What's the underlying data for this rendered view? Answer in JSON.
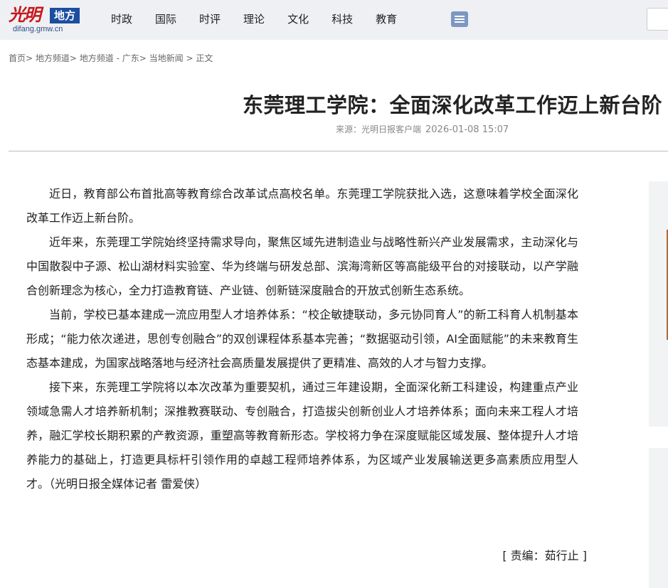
{
  "header": {
    "logo": {
      "script_text": "光明",
      "box_text": "地方",
      "url_text": "difang.gmw.cn"
    },
    "nav": [
      "时政",
      "国际",
      "时评",
      "理论",
      "文化",
      "科技",
      "教育"
    ],
    "menu_icon": "list-menu-icon"
  },
  "breadcrumb": {
    "items": [
      "首页",
      "地方频道",
      "地方频道 - 广东",
      "当地新闻"
    ],
    "current": "正文"
  },
  "article": {
    "title": "东莞理工学院：全面深化改革工作迈上新台阶",
    "source": "来源：光明日报客户端",
    "time": "2026-01-08 15:07",
    "paragraphs": [
      "近日，教育部公布首批高等教育综合改革试点高校名单。东莞理工学院获批入选，这意味着学校全面深化改革工作迈上新台阶。",
      "近年来，东莞理工学院始终坚持需求导向，聚焦区域先进制造业与战略性新兴产业发展需求，主动深化与中国散裂中子源、松山湖材料实验室、华为终端与研发总部、滨海湾新区等高能级平台的对接联动，以产学融合创新理念为核心，全力打造教育链、产业链、创新链深度融合的开放式创新生态系统。",
      "当前，学校已基本建成一流应用型人才培养体系：“校企敏捷联动，多元协同育人”的新工科育人机制基本形成；“能力依次递进，思创专创融合”的双创课程体系基本完善；“数据驱动引领，AI全面赋能”的未来教育生态基本建成，为国家战略落地与经济社会高质量发展提供了更精准、高效的人才与智力支撑。",
      "接下来，东莞理工学院将以本次改革为重要契机，通过三年建设期，全面深化新工科建设，构建重点产业领域急需人才培养新机制；深推教赛联动、专创融合，打造拔尖创新创业人才培养体系；面向未来工程人才培养，融汇学校长期积累的产教资源，重塑高等教育新形态。学校将力争在深度赋能区域发展、整体提升人才培养能力的基础上，打造更具标杆引领作用的卓越工程师培养体系，为区域产业发展输送更多高素质应用型人才。（光明日报全媒体记者 雷爱侠）"
    ],
    "editor": "[ 责编：茹行止 ]"
  }
}
